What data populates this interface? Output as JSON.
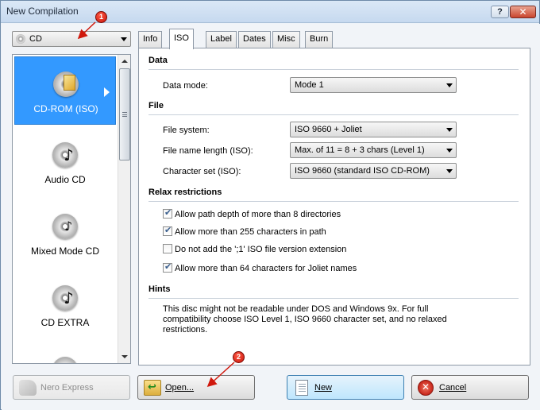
{
  "window": {
    "title": "New Compilation",
    "help_label": "?",
    "close_label": "✕"
  },
  "media_select": {
    "value": "CD"
  },
  "compilation_types": [
    {
      "label": "CD-ROM (ISO)",
      "icon": "cd-rom-iso-icon",
      "selected": true
    },
    {
      "label": "Audio CD",
      "icon": "audio-cd-icon",
      "selected": false
    },
    {
      "label": "Mixed Mode CD",
      "icon": "mixed-mode-cd-icon",
      "selected": false
    },
    {
      "label": "CD EXTRA",
      "icon": "cd-extra-icon",
      "selected": false
    }
  ],
  "tabs": [
    {
      "label": "Info",
      "active": false
    },
    {
      "label": "ISO",
      "active": true
    },
    {
      "label": "Label",
      "active": false
    },
    {
      "label": "Dates",
      "active": false
    },
    {
      "label": "Misc",
      "active": false
    },
    {
      "label": "Burn",
      "active": false
    }
  ],
  "iso": {
    "data_section": "Data",
    "data_mode_label": "Data mode:",
    "data_mode_value": "Mode 1",
    "file_section": "File",
    "file_system_label": "File system:",
    "file_system_value": "ISO 9660 + Joliet",
    "file_name_length_label": "File name length (ISO):",
    "file_name_length_value": "Max. of 11 = 8 + 3 chars (Level 1)",
    "character_set_label": "Character set (ISO):",
    "character_set_value": "ISO 9660 (standard ISO CD-ROM)",
    "relax_section": "Relax restrictions",
    "relax_options": [
      {
        "label": "Allow path depth of more than 8 directories",
        "checked": true
      },
      {
        "label": "Allow more than 255 characters in path",
        "checked": true
      },
      {
        "label": "Do not add the ';1' ISO file version extension",
        "checked": false
      },
      {
        "label": "Allow more than 64 characters for Joliet names",
        "checked": true
      }
    ],
    "hints_section": "Hints",
    "hint_text": "This disc might not be readable under DOS and Windows 9x. For full compatibility choose ISO Level 1, ISO 9660 character set, and no relaxed restrictions."
  },
  "buttons": {
    "nero_express": "Nero Express",
    "open": "Open...",
    "new": "New",
    "cancel": "Cancel"
  },
  "callouts": {
    "one": "1",
    "two": "2"
  },
  "colors": {
    "selection": "#3399ff",
    "callout": "#d0180c"
  }
}
